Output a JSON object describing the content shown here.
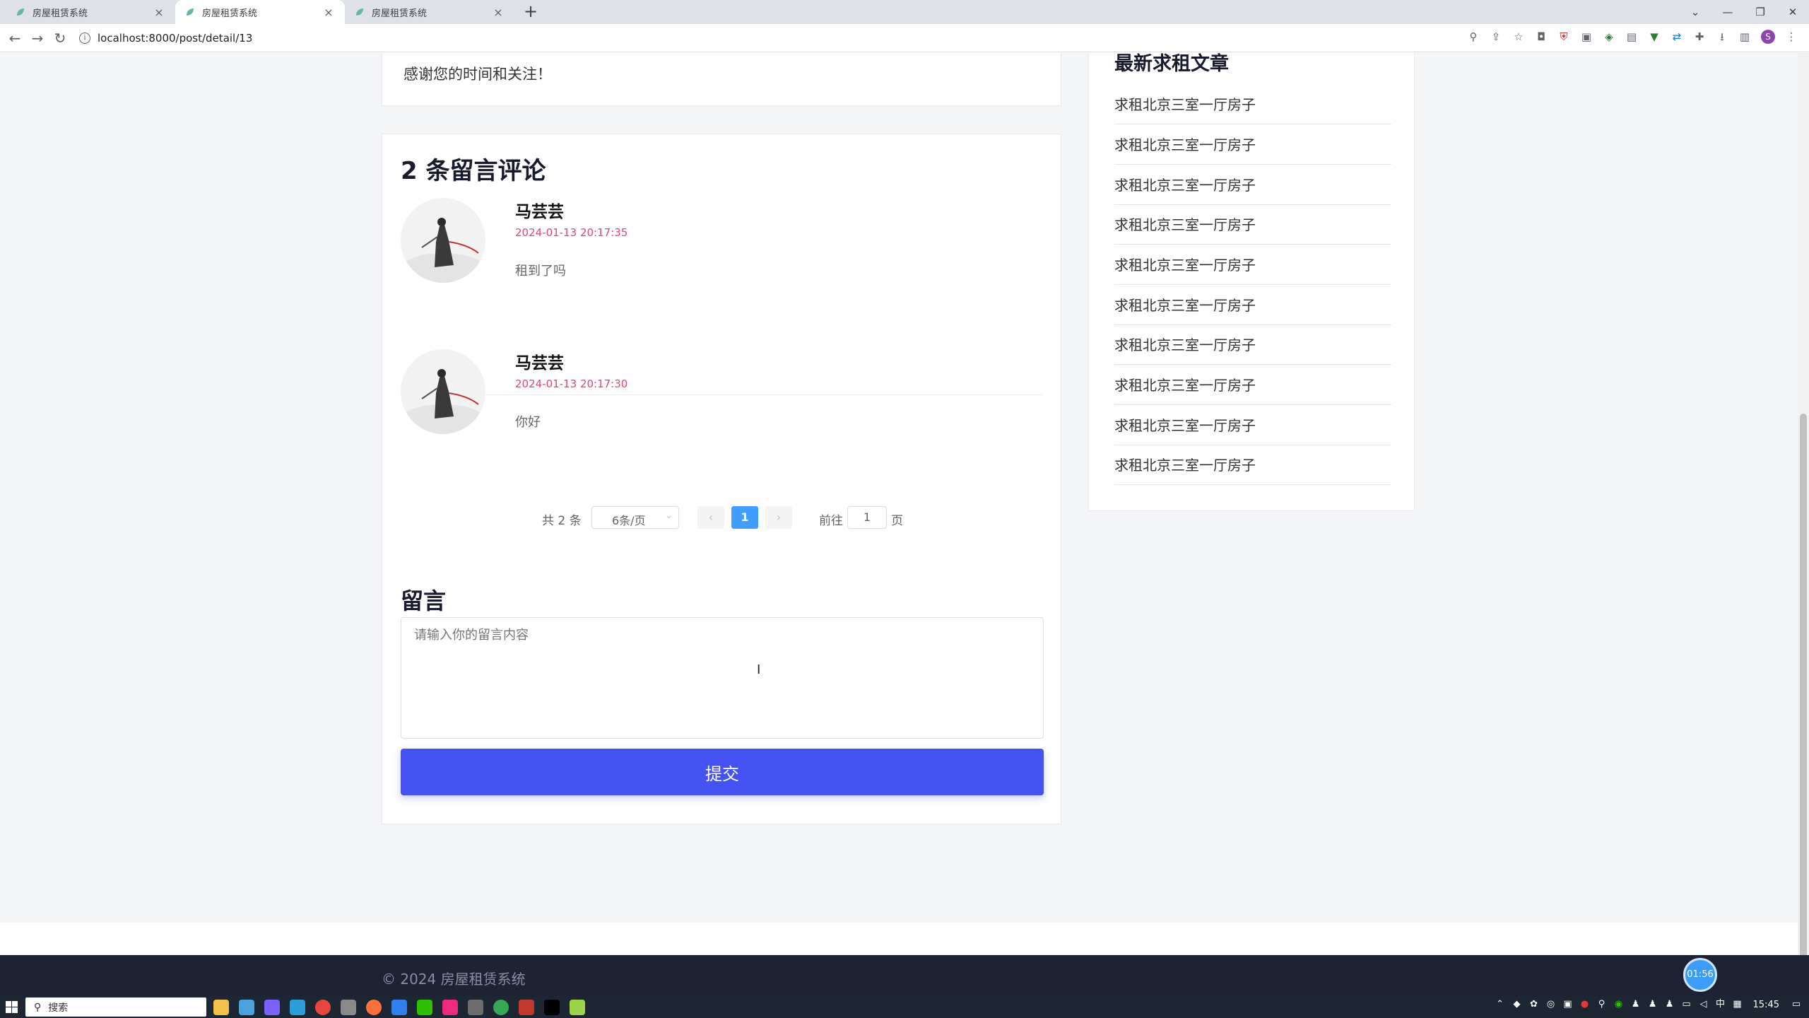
{
  "browser": {
    "tabs": [
      {
        "title": "房屋租赁系统",
        "active": false
      },
      {
        "title": "房屋租赁系统",
        "active": true
      },
      {
        "title": "房屋租赁系统",
        "active": false
      }
    ],
    "new_tab": "+",
    "url": "localhost:8000/post/detail/13",
    "profile_initial": "S"
  },
  "post": {
    "closing_text": "感谢您的时间和关注！"
  },
  "comments": {
    "title": "2 条留言评论",
    "items": [
      {
        "name": "马芸芸",
        "time": "2024-01-13 20:17:35",
        "text": "租到了吗"
      },
      {
        "name": "马芸芸",
        "time": "2024-01-13 20:17:30",
        "text": "你好"
      }
    ],
    "pagination": {
      "total": "共 2 条",
      "page_size": "6条/页",
      "prev": "‹",
      "current_page": "1",
      "next": "›",
      "goto_label": "前往",
      "goto_value": "1",
      "page_label": "页"
    }
  },
  "message_form": {
    "title": "留言",
    "placeholder": "请输入你的留言内容",
    "submit_label": "提交"
  },
  "sidebar": {
    "title": "最新求租文章",
    "items": [
      "求租北京三室一厅房子",
      "求租北京三室一厅房子",
      "求租北京三室一厅房子",
      "求租北京三室一厅房子",
      "求租北京三室一厅房子",
      "求租北京三室一厅房子",
      "求租北京三室一厅房子",
      "求租北京三室一厅房子",
      "求租北京三室一厅房子",
      "求租北京三室一厅房子"
    ]
  },
  "footer": {
    "copyright": "© 2024 房屋租赁系统"
  },
  "timer_badge": "01:56",
  "taskbar": {
    "search_label": "搜索",
    "ime": "中",
    "clock": "15:45"
  },
  "colors": {
    "accent": "#4352f0",
    "page_active": "#409eff",
    "comment_time": "#e0457b",
    "footer_bg": "#1e2235"
  }
}
